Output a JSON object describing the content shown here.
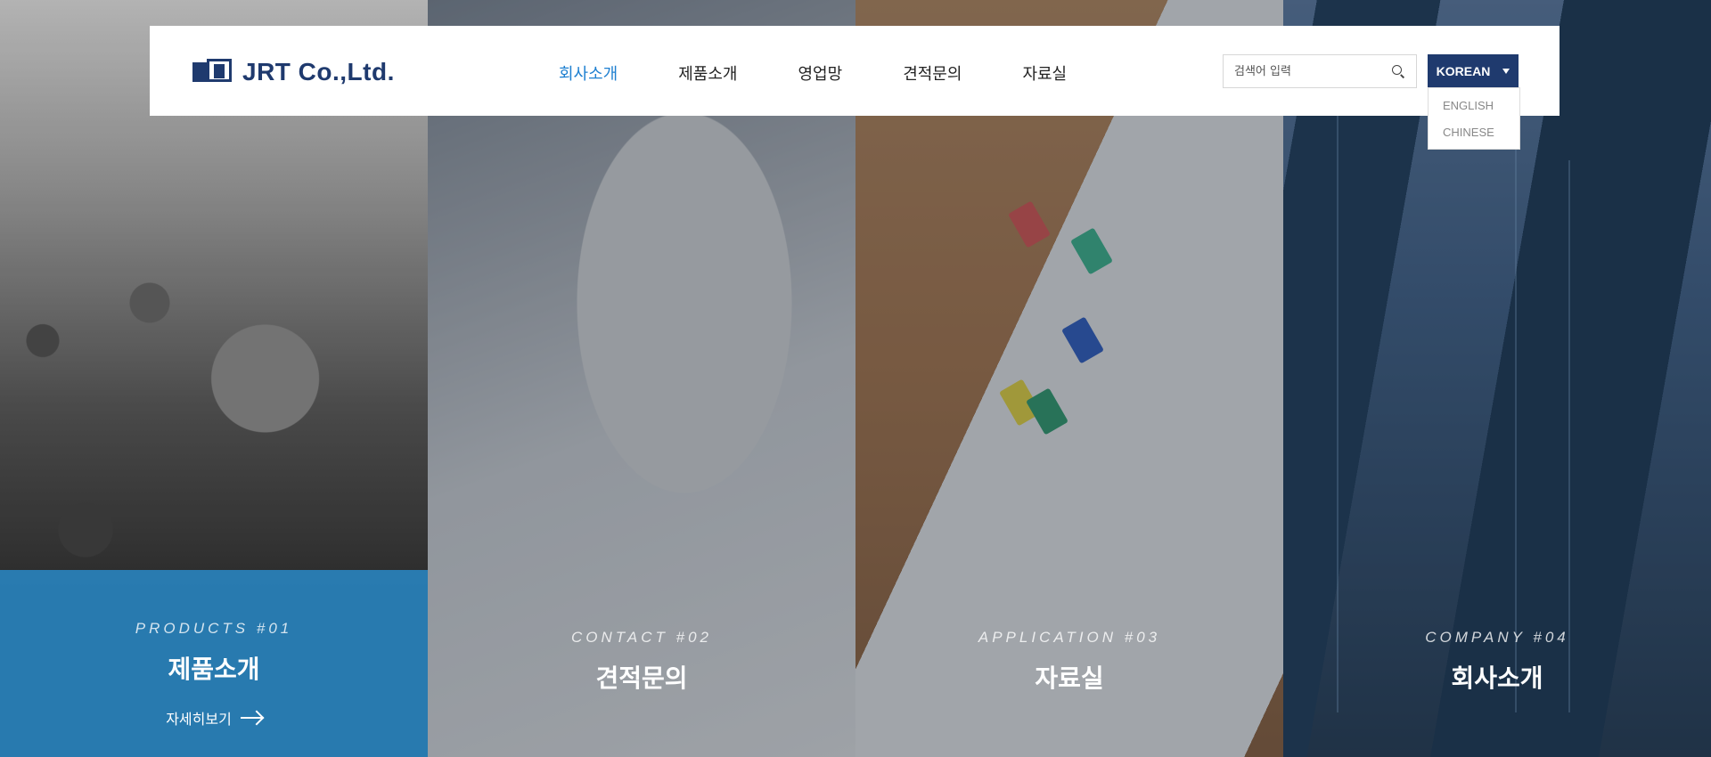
{
  "header": {
    "logo_text": "JRT Co.,Ltd.",
    "nav": [
      {
        "label": "회사소개",
        "active": true
      },
      {
        "label": "제품소개",
        "active": false
      },
      {
        "label": "영업망",
        "active": false
      },
      {
        "label": "견적문의",
        "active": false
      },
      {
        "label": "자료실",
        "active": false
      }
    ],
    "search": {
      "placeholder": "검색어 입력",
      "icon": "search-icon"
    },
    "language": {
      "selected": "KOREAN",
      "options": [
        "ENGLISH",
        "CHINESE"
      ]
    }
  },
  "panels": [
    {
      "sub": "PRODUCTS #01",
      "title": "제품소개",
      "more": "자세히보기",
      "highlighted": true
    },
    {
      "sub": "CONTACT #02",
      "title": "견적문의"
    },
    {
      "sub": "APPLICATION #03",
      "title": "자료실"
    },
    {
      "sub": "COMPANY #04",
      "title": "회사소개"
    }
  ],
  "colors": {
    "brand": "#1f3a6e",
    "nav_active": "#1d7fd0",
    "panel_highlight": "#288ccd"
  }
}
